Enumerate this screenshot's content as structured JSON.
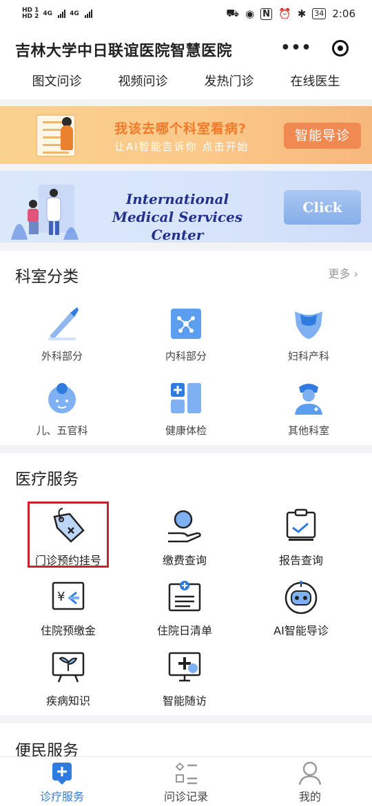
{
  "status_bar": {
    "sim1": "HD 1",
    "sim2": "HD 2",
    "net1": "4G",
    "net2": "4G",
    "battery": "34",
    "time": "2:06"
  },
  "header": {
    "app_title": "吉林大学中日联谊医院智慧医院",
    "more_label": "•••",
    "tabs": [
      "图文问诊",
      "视频问诊",
      "发热门诊",
      "在线医生"
    ]
  },
  "banner_guide": {
    "title": "我该去哪个科室看病?",
    "subtitle": "让AI智能告诉你  点击开始",
    "button": "智能导诊"
  },
  "banner_international": {
    "title": "International Medical Services Center",
    "button": "Click"
  },
  "departments": {
    "title": "科室分类",
    "more": "更多",
    "items": [
      {
        "label": "外科部分",
        "icon": "scalpel-icon"
      },
      {
        "label": "内科部分",
        "icon": "molecule-icon"
      },
      {
        "label": "妇科产科",
        "icon": "pelvis-icon"
      },
      {
        "label": "儿、五官科",
        "icon": "baby-icon"
      },
      {
        "label": "健康体检",
        "icon": "medical-cross-icon"
      },
      {
        "label": "其他科室",
        "icon": "nurse-icon"
      }
    ]
  },
  "medical_services": {
    "title": "医疗服务",
    "items": [
      {
        "label": "门诊预约挂号",
        "icon": "tag-icon"
      },
      {
        "label": "缴费查询",
        "icon": "payment-hand-icon"
      },
      {
        "label": "报告查询",
        "icon": "report-clipboard-icon"
      },
      {
        "label": "住院预缴金",
        "icon": "yuan-prepay-icon"
      },
      {
        "label": "住院日清单",
        "icon": "daily-list-icon"
      },
      {
        "label": "AI智能导诊",
        "icon": "robot-icon"
      },
      {
        "label": "疾病知识",
        "icon": "plant-board-icon"
      },
      {
        "label": "智能随访",
        "icon": "monitor-cross-icon"
      }
    ]
  },
  "convenience": {
    "title": "便民服务"
  },
  "tabbar": {
    "items": [
      {
        "label": "诊疗服务",
        "active": true
      },
      {
        "label": "问诊记录",
        "active": false
      },
      {
        "label": "我的",
        "active": false
      }
    ]
  },
  "colors": {
    "accent": "#2f7be0",
    "highlight": "#c8222a",
    "guide_orange": "#f08a52"
  }
}
